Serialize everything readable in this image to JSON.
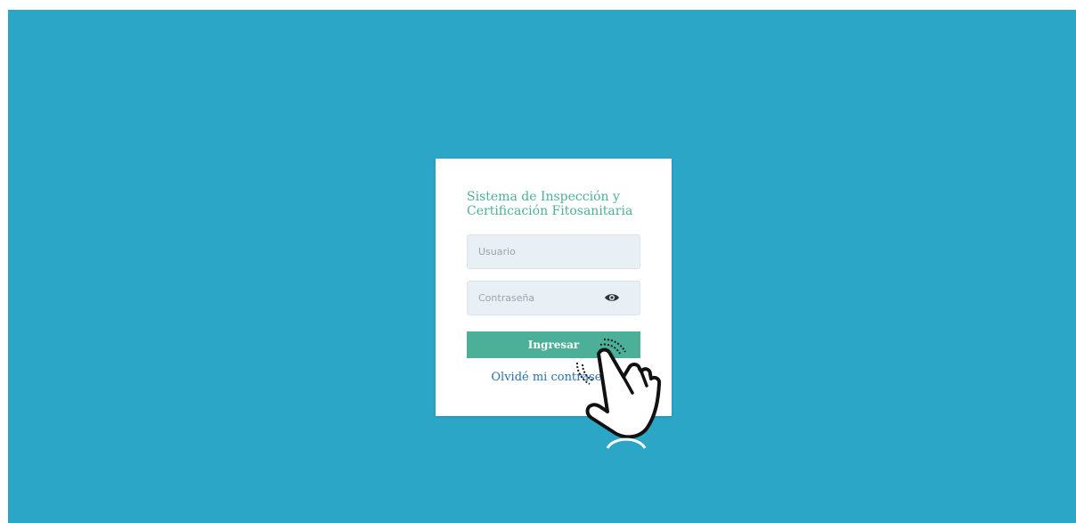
{
  "login": {
    "title_line1": "Sistema de Inspección y",
    "title_line2": "Certificación Fitosanitaria",
    "username_placeholder": "Usuario",
    "password_placeholder": "Contraseña",
    "submit_label": "Ingresar",
    "forgot_link": "Olvidé mi contraseña"
  },
  "icons": {
    "toggle_password": "eye-icon",
    "pointer": "hand-tap-icon"
  },
  "colors": {
    "background": "#2ca6c7",
    "accent": "#4caf98",
    "link": "#2a6fae",
    "input_bg": "#e8f0f6"
  }
}
